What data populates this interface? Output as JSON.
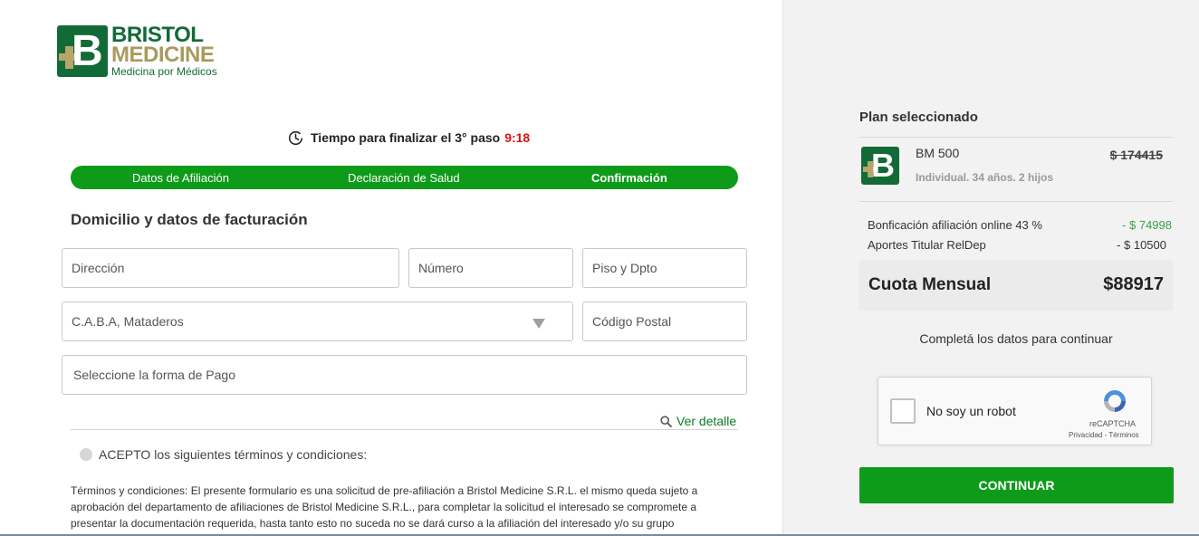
{
  "brand": {
    "name_line1": "BRISTOL",
    "name_line2": "MEDICINE",
    "tagline": "Medicina por Médicos",
    "logo_letter": "B",
    "colors": {
      "primary": "#126b36",
      "gold": "#b6a66c"
    }
  },
  "timer": {
    "label": "Tiempo para finalizar el 3° paso",
    "time": "9:18",
    "icon": "clock-icon"
  },
  "steps": [
    {
      "label": "Datos de Afiliación",
      "active": false
    },
    {
      "label": "Declaración de Salud",
      "active": false
    },
    {
      "label": "Confirmación",
      "active": true
    }
  ],
  "form": {
    "section_title": "Domicilio y datos de facturación",
    "direccion_placeholder": "Dirección",
    "numero_placeholder": "Número",
    "piso_placeholder": "Piso y Dpto",
    "localidad_value": "C.A.B.A, Mataderos",
    "codigo_postal_placeholder": "Código Postal",
    "forma_pago_placeholder": "Seleccione la forma de Pago",
    "ver_detalle": "Ver detalle",
    "accept_label": "ACEPTO los siguientes términos y condiciones:",
    "terms_text": "Términos y condiciones: El presente formulario es una solicitud de pre-afiliación a Bristol Medicine S.R.L. el mismo queda sujeto a aprobación del departamento de afiliaciones de Bristol Medicine S.R.L., para completar la solicitud el interesado se compromete a presentar la documentación requerida, hasta tanto esto no suceda no se dará curso a la afiliación del interesado y/o su grupo"
  },
  "plan": {
    "title": "Plan seleccionado",
    "name": "BM 500",
    "description": "Individual. 34 años. 2 hijos",
    "old_price": "$ 174415",
    "lines": [
      {
        "label": "Bonficación afiliación online 43 %",
        "amount": "- $ 74998",
        "green": true
      },
      {
        "label": "Aportes Titular RelDep",
        "amount": "- $ 10500",
        "green": false
      }
    ],
    "cuota_label": "Cuota Mensual",
    "cuota_value": "$88917",
    "complete_msg": "Completá los datos para continuar",
    "captcha_label": "No soy un robot",
    "captcha_brand": "reCAPTCHA",
    "captcha_links": "Privacidad - Términos",
    "continue_label": "CONTINUAR",
    "colors": {
      "button": "#0f9b1a",
      "discount": "#3aa24a",
      "timer": "#e11010"
    }
  }
}
